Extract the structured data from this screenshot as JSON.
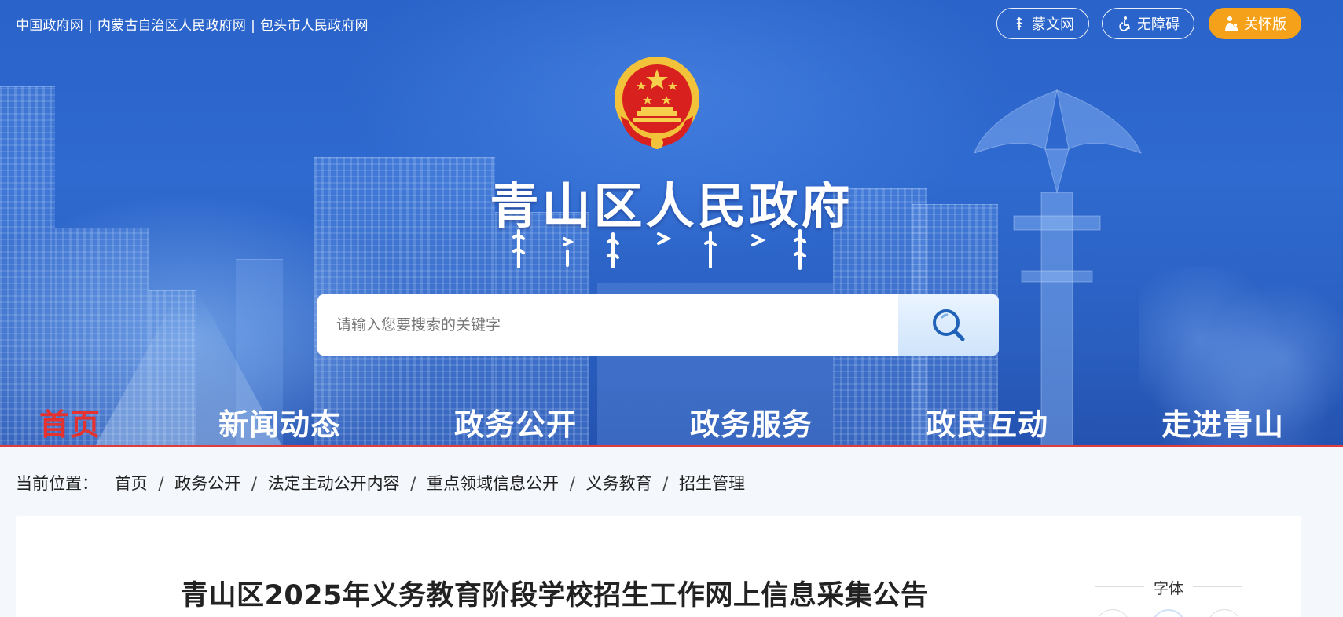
{
  "top_links": [
    "中国政府网",
    "内蒙古自治区人民政府网",
    "包头市人民政府网"
  ],
  "top_link_separator": "|",
  "header_buttons": {
    "mongolian": "蒙文网",
    "accessibility": "无障碍",
    "care": "关怀版"
  },
  "site_title": "青山区人民政府",
  "search": {
    "placeholder": "请输入您要搜索的关键字"
  },
  "nav": [
    {
      "label": "首页",
      "active": true
    },
    {
      "label": "新闻动态",
      "active": false
    },
    {
      "label": "政务公开",
      "active": false
    },
    {
      "label": "政务服务",
      "active": false
    },
    {
      "label": "政民互动",
      "active": false
    },
    {
      "label": "走进青山",
      "active": false
    }
  ],
  "breadcrumb": {
    "label": "当前位置：",
    "separator": "/",
    "items": [
      "首页",
      "政务公开",
      "法定主动公开内容",
      "重点领域信息公开",
      "义务教育",
      "招生管理"
    ]
  },
  "article": {
    "title": "青山区2025年义务教育阶段学校招生工作网上信息采集公告"
  },
  "font_size_panel": {
    "label": "字体"
  },
  "colors": {
    "banner_blue": "#2a63c9",
    "nav_active": "#e5322e",
    "care_button": "#f5a11a"
  },
  "icons": {
    "search": "magnifier-icon",
    "mongolian": "mongolian-script-icon",
    "accessibility": "wheelchair-icon",
    "care": "elderly-care-icon"
  }
}
